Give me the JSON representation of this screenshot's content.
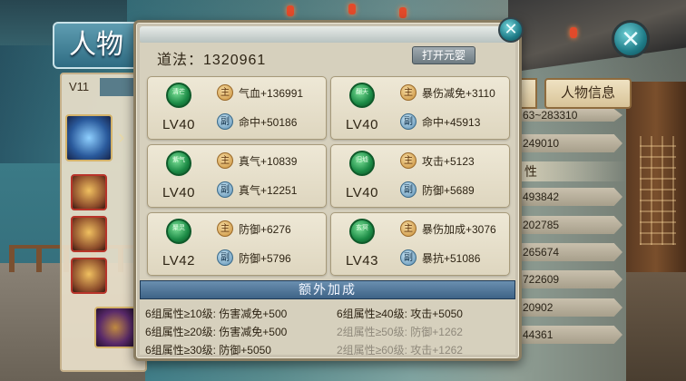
{
  "background": {
    "under_title": "人物",
    "under_level": "V11",
    "tab_info": "人物信息",
    "section_head": "性",
    "stat_values": [
      "63~283310",
      "249010",
      "493842",
      "202785",
      "265674",
      "722609",
      "20902",
      "44361"
    ]
  },
  "modal": {
    "daofa_label": "道法：",
    "daofa_value": "1320961",
    "open_button": "打开元婴",
    "close": "✕",
    "cards": [
      {
        "gem": "清芒",
        "level": "LV40",
        "main_tag": "主",
        "main": "气血+136991",
        "sub_tag": "副",
        "sub": "命中+50186"
      },
      {
        "gem": "翻天",
        "level": "LV40",
        "main_tag": "主",
        "main": "暴伤减免+3110",
        "sub_tag": "副",
        "sub": "命中+45913"
      },
      {
        "gem": "紫气",
        "level": "LV40",
        "main_tag": "主",
        "main": "真气+10839",
        "sub_tag": "副",
        "sub": "真气+12251"
      },
      {
        "gem": "归墟",
        "level": "LV40",
        "main_tag": "主",
        "main": "攻击+5123",
        "sub_tag": "副",
        "sub": "防御+5689"
      },
      {
        "gem": "聚灵",
        "level": "LV42",
        "main_tag": "主",
        "main": "防御+6276",
        "sub_tag": "副",
        "sub": "防御+5796"
      },
      {
        "gem": "玄冥",
        "level": "LV43",
        "main_tag": "主",
        "main": "暴伤加成+3076",
        "sub_tag": "副",
        "sub": "暴抗+51086"
      }
    ],
    "bonus_title": "额外加成",
    "bonuses": [
      {
        "text": "6组属性≥10级: 伤害减免+500",
        "active": true
      },
      {
        "text": "6组属性≥40级: 攻击+5050",
        "active": true
      },
      {
        "text": "6组属性≥20级: 伤害减免+500",
        "active": true
      },
      {
        "text": "2组属性≥50级: 防御+1262",
        "active": false
      },
      {
        "text": "6组属性≥30级: 防御+5050",
        "active": true
      },
      {
        "text": "2组属性≥60级: 攻击+1262",
        "active": false
      }
    ]
  }
}
